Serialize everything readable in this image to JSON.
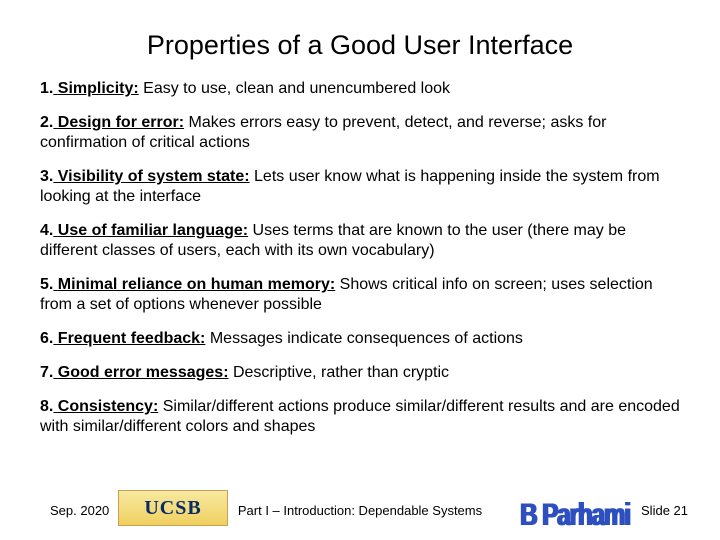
{
  "title": "Properties of a Good User Interface",
  "items": [
    {
      "num": "1.",
      "label": "Simplicity:",
      "text": " Easy to use, clean and unencumbered look"
    },
    {
      "num": "2.",
      "label": "Design for error:",
      "text": " Makes errors easy to prevent, detect, and reverse; asks for confirmation of critical actions"
    },
    {
      "num": "3.",
      "label": "Visibility of system state:",
      "text": " Lets user know what is happening inside the system from looking at the interface"
    },
    {
      "num": "4.",
      "label": "Use of familiar language:",
      "text": " Uses terms that are known to the user (there may be different classes of users, each with its own vocabulary)"
    },
    {
      "num": "5.",
      "label": "Minimal reliance on human memory:",
      "text": " Shows critical info on screen; uses selection from a set of options whenever possible"
    },
    {
      "num": "6.",
      "label": "Frequent feedback:",
      "text": " Messages indicate consequences of actions"
    },
    {
      "num": "7.",
      "label": "Good error messages:",
      "text": " Descriptive, rather than cryptic"
    },
    {
      "num": "8.",
      "label": "Consistency:",
      "text": " Similar/different actions produce similar/different results and are encoded with similar/different colors and shapes"
    }
  ],
  "footer": {
    "date": "Sep. 2020",
    "logo_text": "UCSB",
    "center": "Part I – Introduction: Dependable Systems",
    "author": "B Parhami",
    "slide_num": "Slide 21"
  }
}
